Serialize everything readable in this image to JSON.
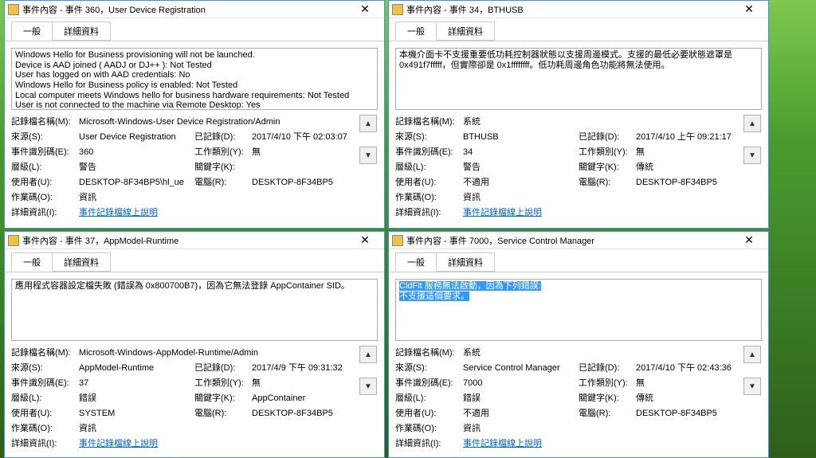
{
  "labels": {
    "tab_general": "一般",
    "tab_detail": "詳細資料",
    "log_name": "記錄檔名稱(M):",
    "source": "來源(S):",
    "logged": "已記錄(D):",
    "event_id": "事件識別碼(E):",
    "task_cat": "工作類別(Y):",
    "level": "層級(L):",
    "keywords": "關鍵字(K):",
    "user": "使用者(U):",
    "computer": "電腦(R):",
    "opcode": "作業碼(O):",
    "more_info": "詳細資訊(I):",
    "help_link": "事件記錄檔線上說明"
  },
  "w1": {
    "title": "事件內容 - 事件 360，User Device Registration",
    "msg": "Windows Hello for Business provisioning will not be launched.\nDevice is AAD joined ( AADJ or DJ++ ): Not Tested\nUser has logged on with AAD credentials: No\nWindows Hello for Business policy is enabled: Not Tested\nLocal computer meets Windows hello for business hardware requirements: Not Tested\nUser is not connected to the machine via Remote Desktop: Yes\nUser certificate for on premise auth policy is enabled: Not Tested",
    "log_name": "Microsoft-Windows-User Device Registration/Admin",
    "source": "User Device Registration",
    "logged": "2017/4/10 下午 02:03:07",
    "event_id": "360",
    "task_cat": "無",
    "level": "警告",
    "keywords": "",
    "user": "DESKTOP-8F34BP5\\hl_ue",
    "computer": "DESKTOP-8F34BP5",
    "opcode": "資訊"
  },
  "w2": {
    "title": "事件內容 - 事件 34，BTHUSB",
    "msg": "本機介面卡不支援重要低功耗控制器狀態以支援周邊模式。支援的最低必要狀態遮罩是 0x491f7fffff，但實際卻是 0x1ffffffff。低功耗周邊角色功能將無法使用。",
    "log_name": "系統",
    "source": "BTHUSB",
    "logged": "2017/4/10 上午 09:21:17",
    "event_id": "34",
    "task_cat": "無",
    "level": "警告",
    "keywords": "傳統",
    "user": "不適用",
    "computer": "DESKTOP-8F34BP5",
    "opcode": "資訊"
  },
  "w3": {
    "title": "事件內容 - 事件 37，AppModel-Runtime",
    "msg": "應用程式容器設定檔失敗 (錯誤為 0x800700B7)，因為它無法登錄 AppContainer SID。",
    "log_name": "Microsoft-Windows-AppModel-Runtime/Admin",
    "source": "AppModel-Runtime",
    "logged": "2017/4/9 下午 09:31:32",
    "event_id": "37",
    "task_cat": "無",
    "level": "錯誤",
    "keywords": "AppContainer",
    "user": "SYSTEM",
    "computer": "DESKTOP-8F34BP5",
    "opcode": "資訊"
  },
  "w4": {
    "title": "事件內容 - 事件 7000，Service Control Manager",
    "msg_sel1": "CldFlt 服務無法啟動，因為下列錯誤:",
    "msg_sel2": "不支援這個要求。",
    "log_name": "系統",
    "source": "Service Control Manager",
    "logged": "2017/4/10 下午 02:43:36",
    "event_id": "7000",
    "task_cat": "無",
    "level": "錯誤",
    "keywords": "傳統",
    "user": "不適用",
    "computer": "DESKTOP-8F34BP5",
    "opcode": "資訊"
  }
}
